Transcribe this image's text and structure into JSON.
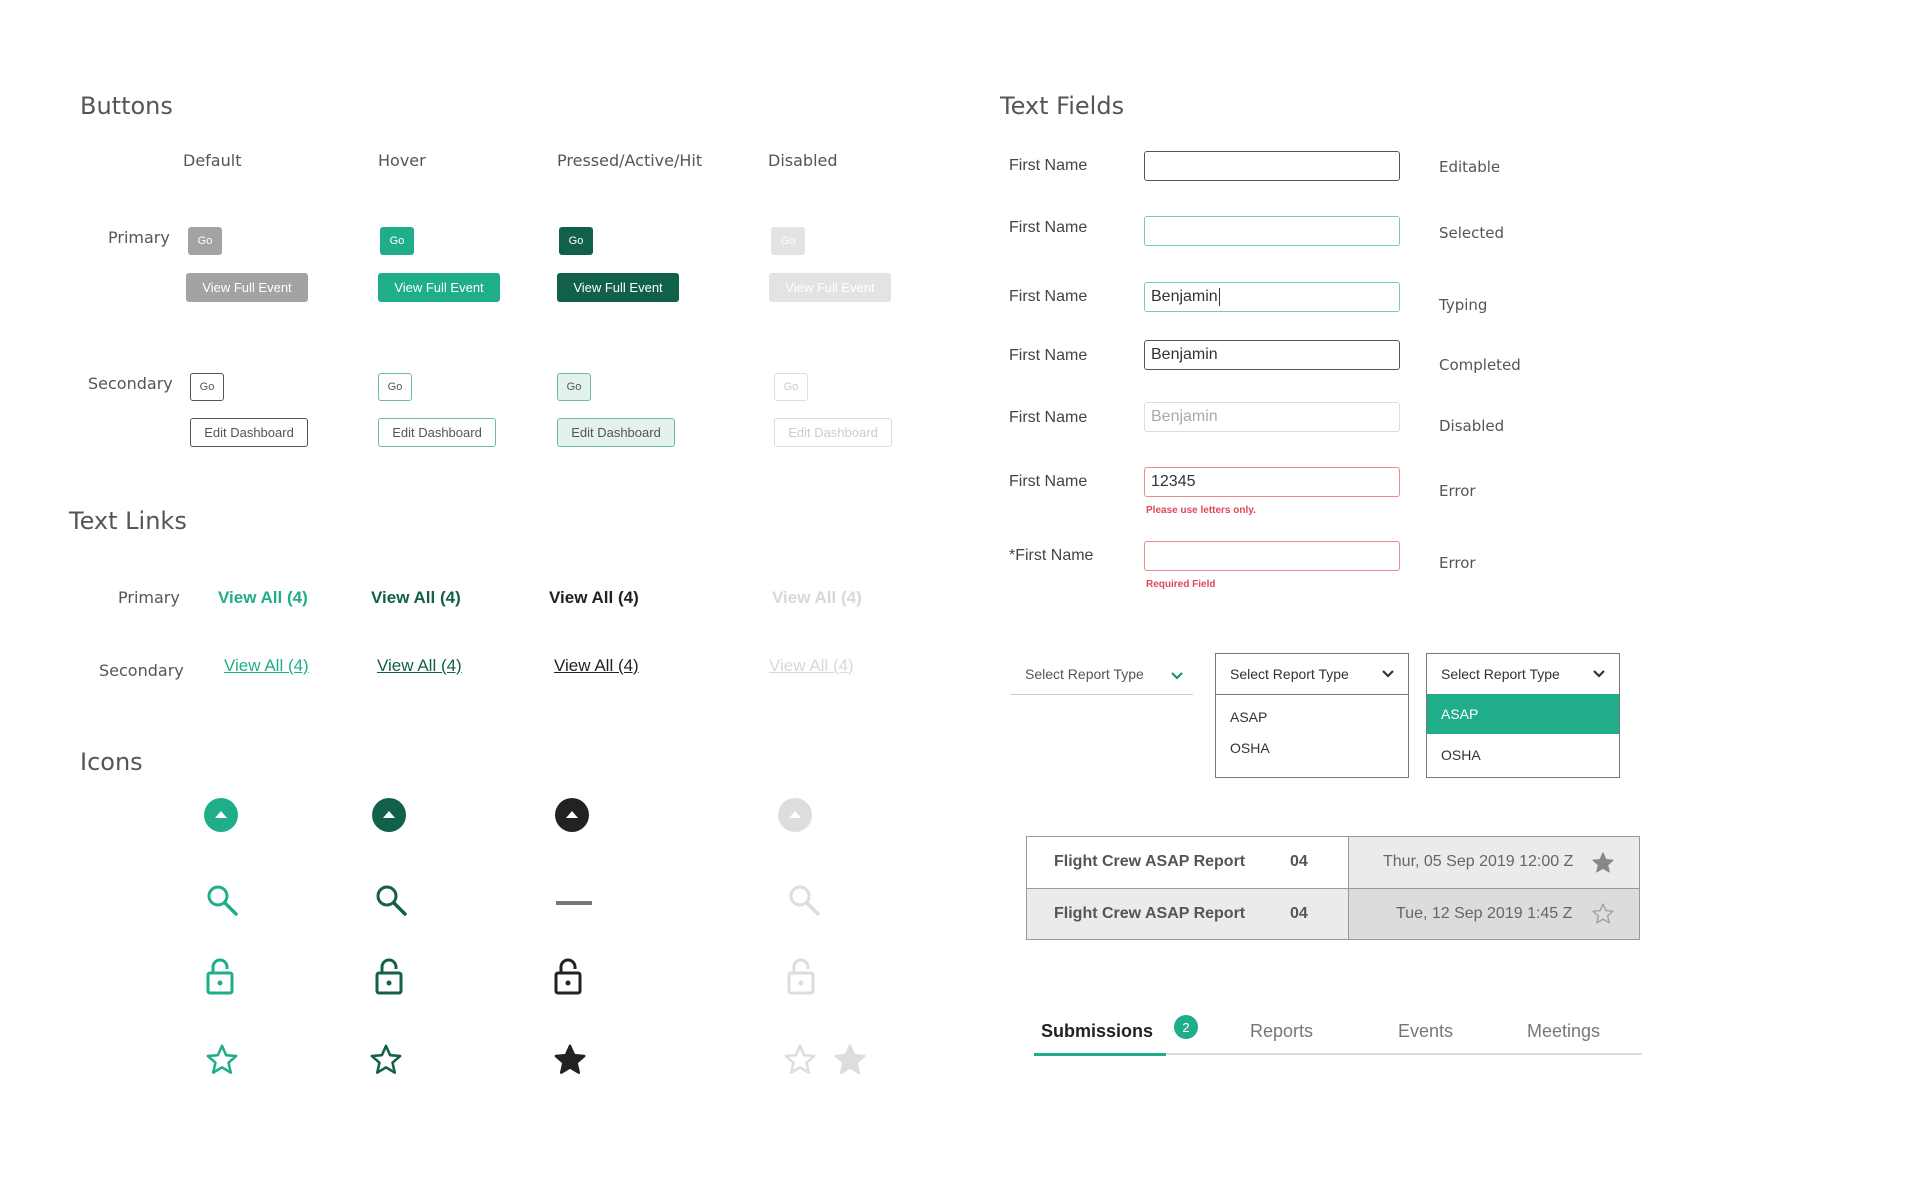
{
  "buttons": {
    "title": "Buttons",
    "columns": [
      "Default",
      "Hover",
      "Pressed/Active/Hit",
      "Disabled"
    ],
    "rows": {
      "primary": "Primary",
      "secondary": "Secondary"
    },
    "go_label": "Go",
    "view_full_event_label": "View Full Event",
    "edit_dashboard_label": "Edit Dashboard"
  },
  "text_links": {
    "title": "Text Links",
    "rows": {
      "primary": "Primary",
      "secondary": "Secondary"
    },
    "link_label": "View All (4)"
  },
  "icons": {
    "title": "Icons",
    "states": [
      "default",
      "hover",
      "pressed",
      "disabled"
    ],
    "row_icons": [
      "chevron-up-circle-icon",
      "search-icon",
      "lock-icon",
      "star-icon"
    ],
    "pressed_search_icon": "minus-icon"
  },
  "text_fields": {
    "title": "Text Fields",
    "fields": [
      {
        "label": "First Name",
        "value": "",
        "state": "Editable",
        "kind": "editable"
      },
      {
        "label": "First Name",
        "value": "",
        "state": "Selected",
        "kind": "selected"
      },
      {
        "label": "First Name",
        "value": "Benjamin",
        "state": "Typing",
        "kind": "typing"
      },
      {
        "label": "First Name",
        "value": "Benjamin",
        "state": "Completed",
        "kind": "completed"
      },
      {
        "label": "First Name",
        "value": "Benjamin",
        "state": "Disabled",
        "kind": "disabled"
      },
      {
        "label": "First Name",
        "value": "12345",
        "state": "Error",
        "kind": "error",
        "error": "Please use letters only."
      },
      {
        "label": "*First Name",
        "value": "",
        "state": "Error",
        "kind": "error",
        "error": "Required Field"
      }
    ]
  },
  "dropdowns": {
    "placeholder": "Select Report Type",
    "options": [
      "ASAP",
      "OSHA"
    ]
  },
  "report_table": {
    "rows": [
      {
        "title": "Flight Crew ASAP Report",
        "count": "04",
        "date": "Thur, 05 Sep 2019 12:00 Z",
        "starred": true
      },
      {
        "title": "Flight Crew ASAP Report",
        "count": "04",
        "date": "Tue, 12 Sep 2019 1:45 Z",
        "starred": false
      }
    ]
  },
  "tabs": {
    "items": [
      "Submissions",
      "Reports",
      "Events",
      "Meetings"
    ],
    "badge": "2",
    "active": "Submissions"
  },
  "colors": {
    "primary_green": "#1fae89",
    "dark_green": "#11614a",
    "pressed_black": "#222222",
    "disabled_gray": "#dddddd",
    "error_red": "#e0475a"
  }
}
